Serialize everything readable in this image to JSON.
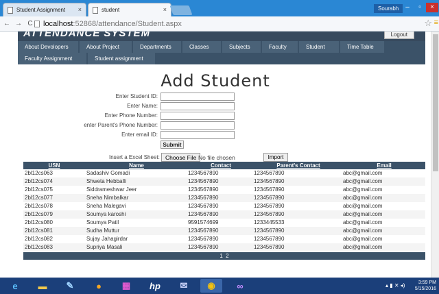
{
  "browser": {
    "tabs": [
      {
        "title": "Student Assignment"
      },
      {
        "title": "student"
      }
    ],
    "user": "Sourabh",
    "url_host": "localhost",
    "url_path": ":52868/attendance/Student.aspx"
  },
  "site": {
    "title": "ATTENDANCE SYSTEM",
    "logout_label": "Logout"
  },
  "nav": {
    "row1": [
      "About Devolopers",
      "About Project",
      "Departments",
      "Classes",
      "Subjects",
      "Faculty",
      "Student",
      "Time Table"
    ],
    "row2": [
      "Faculty Assignment",
      "Student assignment"
    ]
  },
  "form": {
    "title": "Add Student",
    "labels": {
      "student_id": "Enter Student ID:",
      "name": "Enter Name:",
      "phone": "Enter Phone Number:",
      "parent_phone": "enter Parent's Phone Number:",
      "email": "Enter email ID:"
    },
    "submit_label": "Submit",
    "upload_label": "Insert a Excel Sheet:",
    "choose_file_label": "Choose File",
    "no_file_text": "No file chosen",
    "import_label": "Import"
  },
  "table": {
    "headers": [
      "USN",
      "Name",
      "Contact",
      "Parent's Contact",
      "Email"
    ],
    "rows": [
      [
        "2bl12cs063",
        "Sadashiv Gomadi",
        "1234567890",
        "1234567890",
        "abc@gmail.com"
      ],
      [
        "2bl12cs074",
        "Shweta Hebballi",
        "1234567890",
        "1234567890",
        "abc@gmail.com"
      ],
      [
        "2bl12cs075",
        "Siddrameshwar Jeer",
        "1234567890",
        "1234567890",
        "abc@gmail.com"
      ],
      [
        "2bl12cs077",
        "Sneha Nimbalkar",
        "1234567890",
        "1234567890",
        "abc@gmail.com"
      ],
      [
        "2bl12cs078",
        "Sneha Malegavi",
        "1234567890",
        "1234567890",
        "abc@gmail.com"
      ],
      [
        "2bl12cs079",
        "Soumya karoshi",
        "1234567890",
        "1234567890",
        "abc@gmail.com"
      ],
      [
        "2bl12cs080",
        "Soumya Patil",
        "9591574699",
        "1233445533",
        "abc@gmail.com"
      ],
      [
        "2bl12cs081",
        "Sudha Muttur",
        "1234567890",
        "1234567890",
        "abc@gmail.com"
      ],
      [
        "2bl12cs082",
        "Sujay Jahagirdar",
        "1234567890",
        "1234567890",
        "abc@gmail.com"
      ],
      [
        "2bl12cs083",
        "Supriya Masali",
        "1234567890",
        "1234567890",
        "abc@gmail.com"
      ]
    ],
    "pages": [
      "1",
      "2"
    ]
  },
  "taskbar": {
    "time": "3:59 PM",
    "date": "5/15/2016"
  }
}
